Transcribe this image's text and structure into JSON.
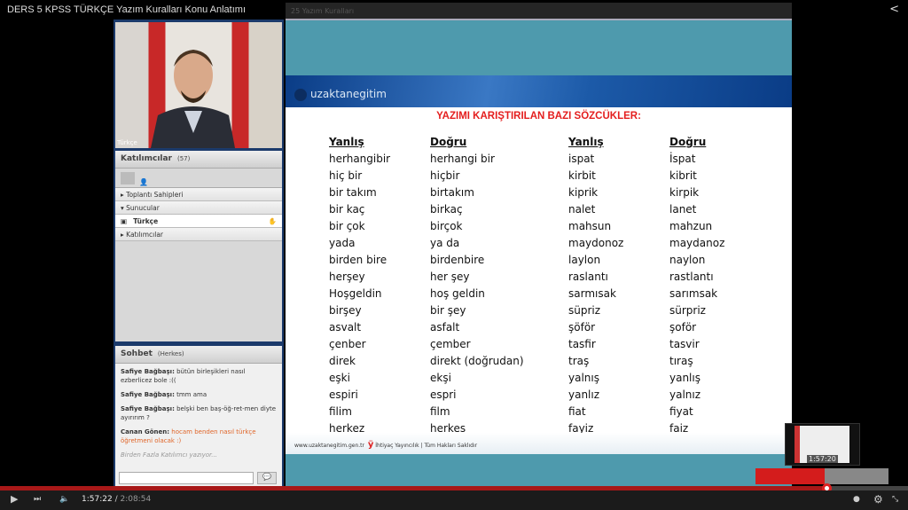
{
  "window": {
    "title": "DERS 5 KPSS TÜRKÇE Yazım Kuralları Konu Anlatımı"
  },
  "webcam": {
    "label": "Türkçe"
  },
  "participants": {
    "title": "Katılımcılar",
    "count": "(57)",
    "groups": [
      "Toplantı Sahipleri",
      "Sunucular",
      "Katılımcılar"
    ],
    "presenter": "Türkçe"
  },
  "chat": {
    "title": "Sohbet",
    "scope": "(Herkes)",
    "messages": [
      {
        "user": "Safiye Bağbaşı:",
        "text": "bütün birleşikleri nasıl ezberlicez bole :((",
        "highlight": false
      },
      {
        "user": "Safiye Bağbaşı:",
        "text": "tmm ama",
        "highlight": false
      },
      {
        "user": "Safiye Bağbaşı:",
        "text": "belşki ben baş-öğ-ret-men diyte ayırırım ?",
        "highlight": false
      },
      {
        "user": "Canan Gönen:",
        "text": "hocam benden nasıl türkçe öğretmeni olacak :)",
        "highlight": true
      }
    ],
    "typing": "Birden Fazla Katılımcı yazıyor..."
  },
  "slide": {
    "topbar": "25 Yazım Kuralları",
    "logo": "uzaktanegitim",
    "title": "YAZIMI KARIŞTIRILAN BAZI SÖZCÜKLER:",
    "columns": [
      {
        "header": "Yanlış",
        "words": [
          "herhangibir",
          "hiç bir",
          "bir takım",
          "bir kaç",
          "bir çok",
          "yada",
          "birden bire",
          "herşey",
          "Hoşgeldin",
          "birşey",
          "asvalt",
          "çenber",
          "direk",
          "eşki",
          "espiri",
          "filim",
          "herkez"
        ]
      },
      {
        "header": "Doğru",
        "words": [
          "herhangi bir",
          "hiçbir",
          "birtakım",
          "birkaç",
          "birçok",
          "ya da",
          "birdenbire",
          "her şey",
          "hoş geldin",
          "bir şey",
          "asfalt",
          "çember",
          "direkt (doğrudan)",
          "ekşi",
          "espri",
          "film",
          "herkes"
        ]
      },
      {
        "header": "Yanlış",
        "words": [
          "ispat",
          "kirbit",
          "kiprik",
          "nalet",
          "mahsun",
          "maydonoz",
          "laylon",
          "raslantı",
          "sarmısak",
          "süpriz",
          "şöför",
          "tasfir",
          "traş",
          "yalnış",
          "yanlız",
          "fiat",
          "fayiz"
        ]
      },
      {
        "header": "Doğru",
        "words": [
          "İspat",
          "kibrit",
          "kirpik",
          "lanet",
          "mahzun",
          "maydanoz",
          "naylon",
          "rastlantı",
          "sarımsak",
          "sürpriz",
          "şoför",
          "tasvir",
          "tıraş",
          "yanlış",
          "yalnız",
          "fiyat",
          "faiz"
        ]
      }
    ],
    "footer": {
      "url": "www.uzaktanegitim.gen.tr",
      "publisher": "İhtiyaç Yayıncılık | Tüm Hakları Saklıdır"
    }
  },
  "player": {
    "current": "1:57:22",
    "duration": "2:08:54",
    "progress": 0.9105,
    "preview_time": "1:57:20"
  }
}
